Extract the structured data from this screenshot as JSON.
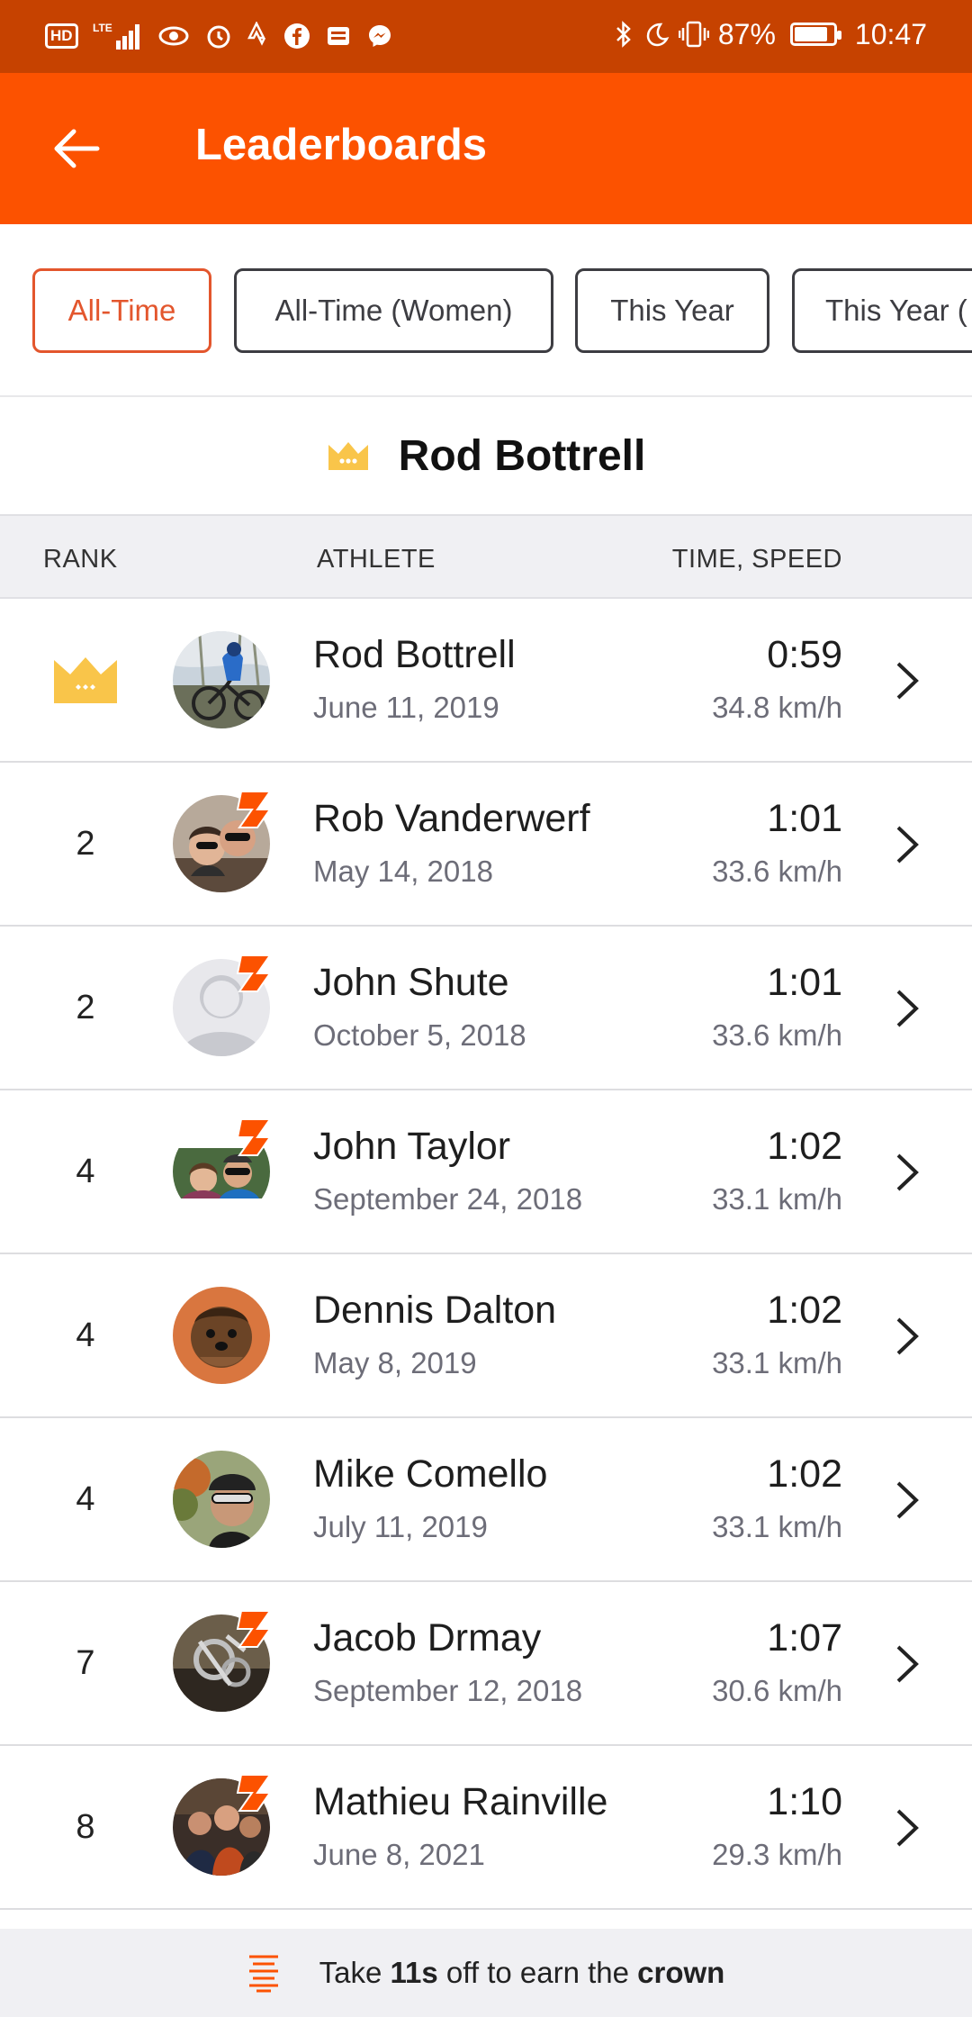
{
  "status_bar": {
    "left_icons": [
      "hd-icon",
      "lte-signal-icon",
      "eye-icon",
      "alarm-icon",
      "strava-icon",
      "facebook-icon",
      "news-icon",
      "messenger-icon"
    ],
    "hd_label": "HD",
    "battery_percent": "87%",
    "battery_level": 0.87,
    "time": "10:47"
  },
  "app_bar": {
    "title": "Leaderboards",
    "background": "#fc5200"
  },
  "filters": [
    {
      "label": "All-Time",
      "selected": true
    },
    {
      "label": "All-Time (Women)",
      "selected": false
    },
    {
      "label": "This Year",
      "selected": false
    },
    {
      "label": "This Year (",
      "selected": false
    }
  ],
  "king": {
    "name": "Rod Bottrell"
  },
  "table_header": {
    "rank": "RANK",
    "athlete": "ATHLETE",
    "time_speed": "TIME, SPEED"
  },
  "rows": [
    {
      "rank": "",
      "crown": true,
      "name": "Rod Bottrell",
      "date": "June 11, 2019",
      "time": "0:59",
      "speed": "34.8 km/h",
      "avatar": "cyclist-photo",
      "subscriber": false
    },
    {
      "rank": "2",
      "crown": false,
      "name": "Rob Vanderwerf",
      "date": "May 14, 2018",
      "time": "1:01",
      "speed": "33.6 km/h",
      "avatar": "couple-selfie-photo",
      "subscriber": true
    },
    {
      "rank": "2",
      "crown": false,
      "name": "John Shute",
      "date": "October 5, 2018",
      "time": "1:01",
      "speed": "33.6 km/h",
      "avatar": "default-avatar",
      "subscriber": true
    },
    {
      "rank": "4",
      "crown": false,
      "name": "John Taylor",
      "date": "September 24, 2018",
      "time": "1:02",
      "speed": "33.1 km/h",
      "avatar": "couple-outdoor-photo",
      "subscriber": true
    },
    {
      "rank": "4",
      "crown": false,
      "name": "Dennis Dalton",
      "date": "May 8, 2019",
      "time": "1:02",
      "speed": "33.1 km/h",
      "avatar": "dog-photo",
      "subscriber": false
    },
    {
      "rank": "4",
      "crown": false,
      "name": "Mike Comello",
      "date": "July 11, 2019",
      "time": "1:02",
      "speed": "33.1 km/h",
      "avatar": "cyclist-helmet-photo",
      "subscriber": false
    },
    {
      "rank": "7",
      "crown": false,
      "name": "Jacob Drmay",
      "date": "September 12, 2018",
      "time": "1:07",
      "speed": "30.6 km/h",
      "avatar": "bike-parts-photo",
      "subscriber": true
    },
    {
      "rank": "8",
      "crown": false,
      "name": "Mathieu Rainville",
      "date": "June 8, 2021",
      "time": "1:10",
      "speed": "29.3 km/h",
      "avatar": "group-photo",
      "subscriber": true
    }
  ],
  "footer": {
    "prefix": "Take ",
    "seconds": "11s",
    "middle": " off to earn the ",
    "crown_word": "crown"
  },
  "colors": {
    "accent": "#fc5200",
    "status_bar": "#c64200",
    "crown": "#f9c54a",
    "active_chip": "#e3562d"
  }
}
